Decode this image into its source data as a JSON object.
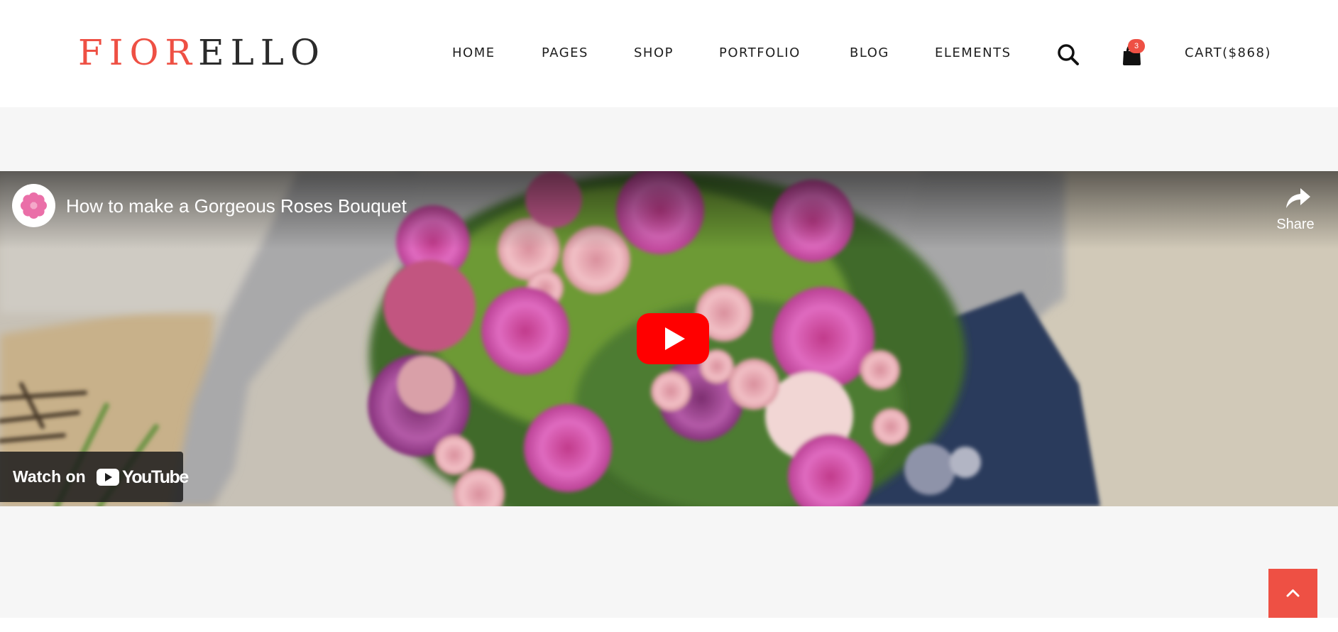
{
  "brand": {
    "logo_accent": "FIOR",
    "logo_rest": "ELLO",
    "accent_color": "#ee5044"
  },
  "nav": {
    "items": [
      {
        "label": "HOME"
      },
      {
        "label": "PAGES"
      },
      {
        "label": "SHOP"
      },
      {
        "label": "PORTFOLIO"
      },
      {
        "label": "BLOG"
      },
      {
        "label": "ELEMENTS"
      }
    ],
    "search_icon": "search-icon",
    "cart_icon": "shopping-bag-icon",
    "cart_count": "3",
    "cart_label": "CART($868)"
  },
  "video": {
    "title": "How to make a Gorgeous Roses Bouquet",
    "share_label": "Share",
    "watch_on_label": "Watch on",
    "youtube_wordmark": "YouTube",
    "play_icon": "play-icon",
    "share_icon": "share-arrow-icon",
    "avatar_icon": "flower-icon",
    "play_color": "#ff0000"
  },
  "back_to_top": {
    "icon": "chevron-up-icon",
    "color": "#ee5044"
  }
}
